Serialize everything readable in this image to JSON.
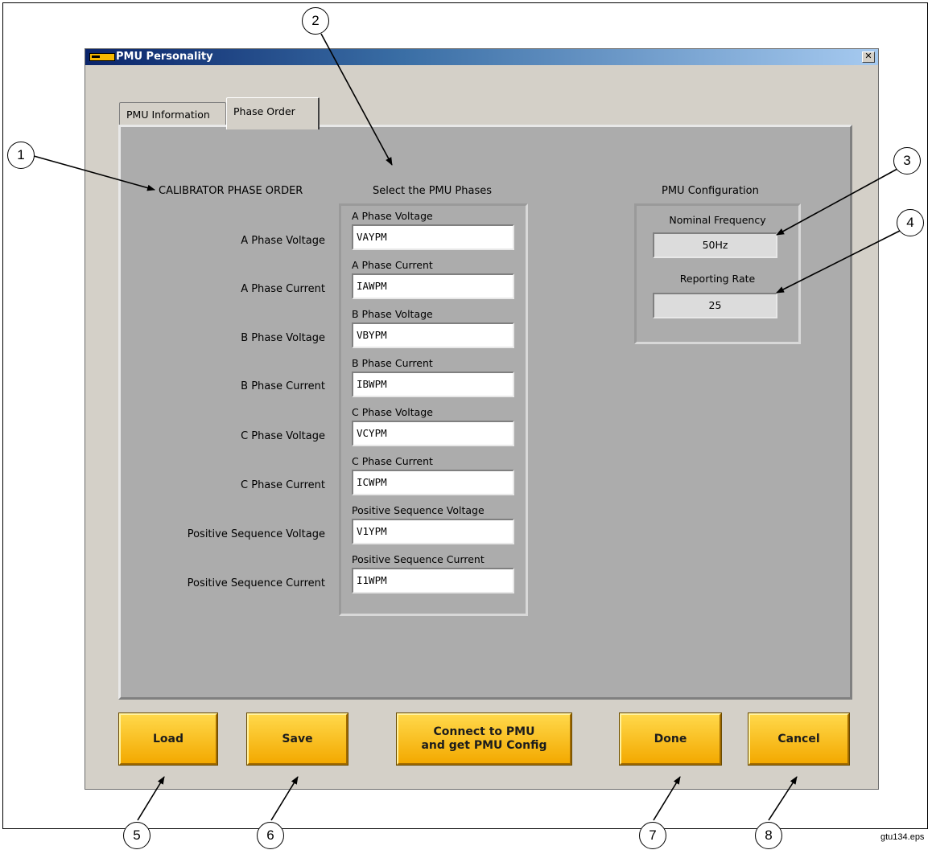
{
  "window": {
    "title": "PMU Personality",
    "close_glyph": "✕",
    "brand_color": "#f5b700"
  },
  "tabs": [
    {
      "label": "PMU Information",
      "selected": false
    },
    {
      "label": "Phase Order",
      "selected": true
    }
  ],
  "calibrator": {
    "heading": "CALIBRATOR PHASE ORDER",
    "rows": [
      "A Phase Voltage",
      "A Phase Current",
      "B Phase Voltage",
      "B Phase Current",
      "C Phase Voltage",
      "C Phase Current",
      "Positive Sequence Voltage",
      "Positive Sequence Current"
    ]
  },
  "pmu_phases": {
    "heading": "Select the PMU Phases",
    "fields": [
      {
        "label": "A Phase Voltage",
        "value": "VAYPM"
      },
      {
        "label": "A Phase Current",
        "value": "IAWPM"
      },
      {
        "label": "B Phase Voltage",
        "value": "VBYPM"
      },
      {
        "label": "B Phase Current",
        "value": "IBWPM"
      },
      {
        "label": "C Phase Voltage",
        "value": "VCYPM"
      },
      {
        "label": "C Phase Current",
        "value": "ICWPM"
      },
      {
        "label": "Positive Sequence Voltage",
        "value": "V1YPM"
      },
      {
        "label": "Positive Sequence Current",
        "value": "I1WPM"
      }
    ]
  },
  "pmu_config": {
    "heading": "PMU Configuration",
    "nominal_frequency_label": "Nominal Frequency",
    "nominal_frequency_value": "50Hz",
    "reporting_rate_label": "Reporting Rate",
    "reporting_rate_value": "25"
  },
  "buttons": {
    "load": "Load",
    "save": "Save",
    "connect_line1": "Connect to PMU",
    "connect_line2": "and get PMU Config",
    "done": "Done",
    "cancel": "Cancel"
  },
  "callouts": [
    "1",
    "2",
    "3",
    "4",
    "5",
    "6",
    "7",
    "8"
  ],
  "footer_tag": "gtu134.eps"
}
